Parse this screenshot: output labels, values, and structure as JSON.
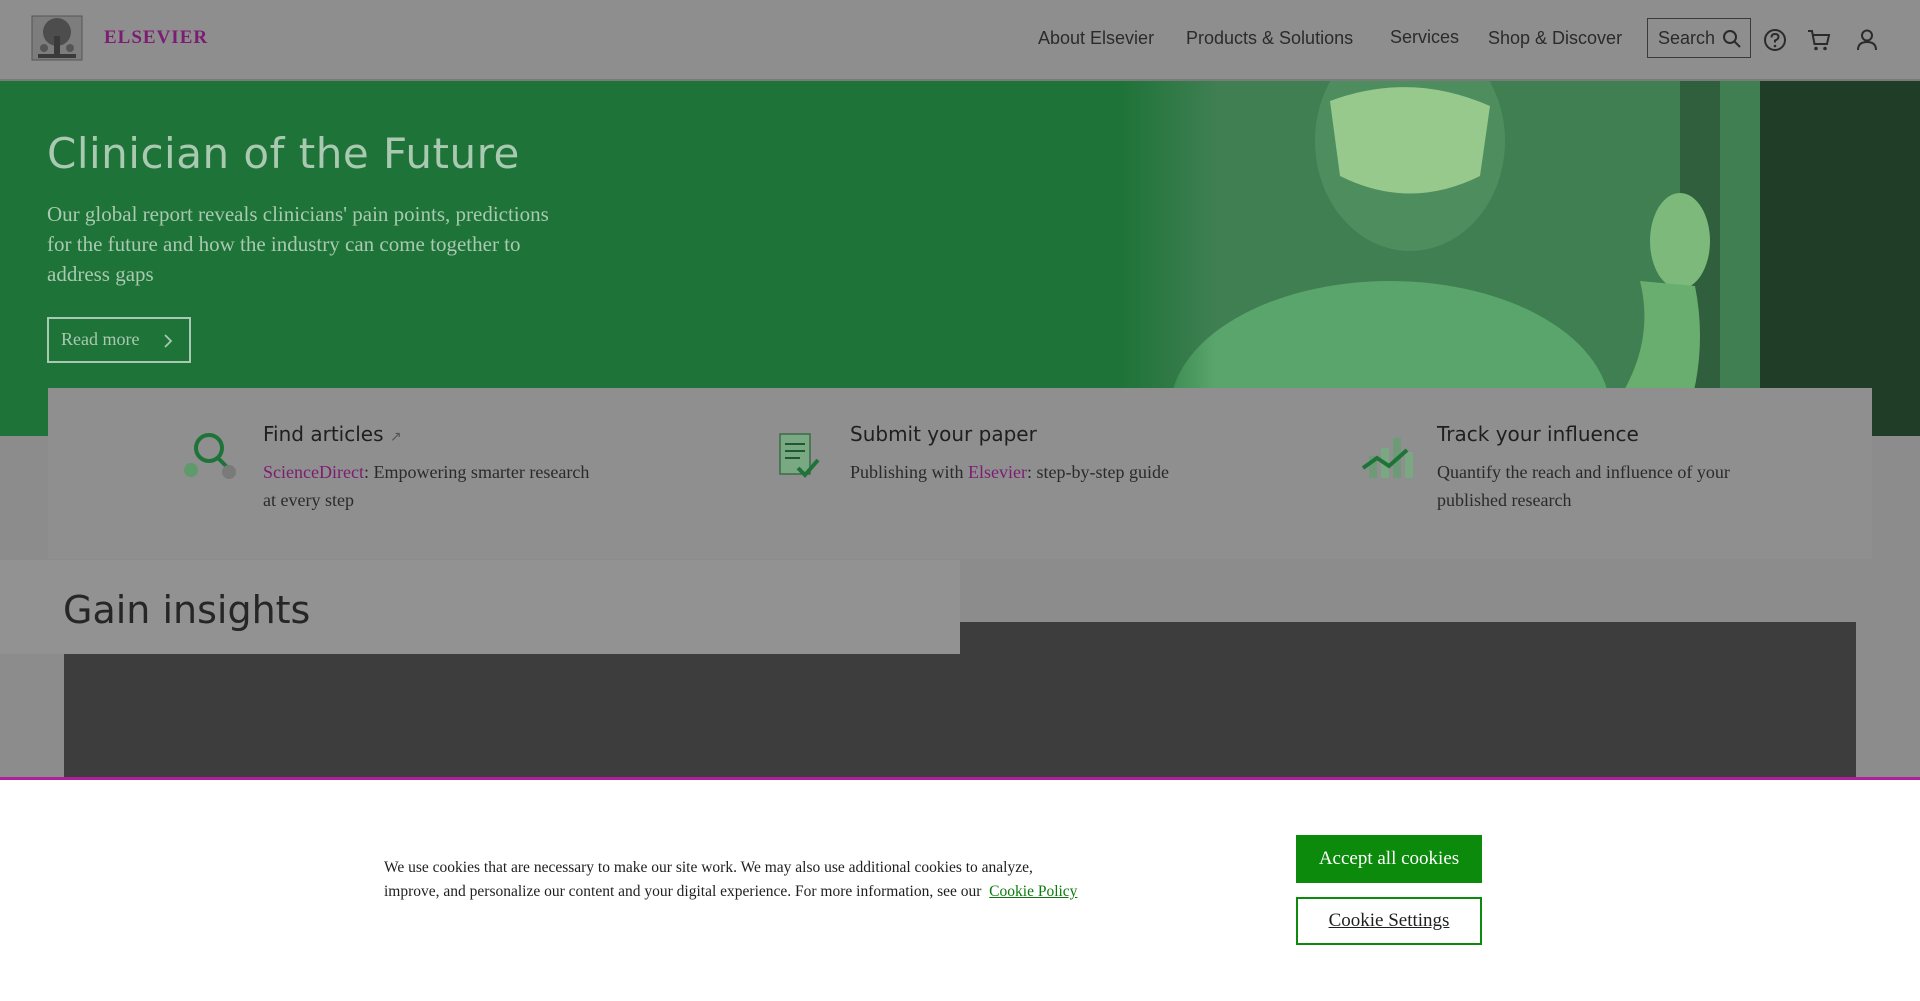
{
  "header": {
    "brand": "ELSEVIER",
    "nav": [
      "About Elsevier",
      "Products & Solutions",
      "Services",
      "Shop & Discover"
    ],
    "search_label": "Search",
    "icons": [
      "help-icon",
      "cart-icon",
      "account-icon"
    ]
  },
  "hero": {
    "title": "Clinician of the Future",
    "subtitle": "Our global report reveals clinicians' pain points, predictions for the future and how the industry can come together to address gaps",
    "button": "Read more"
  },
  "quick_links": [
    {
      "title": "Find articles",
      "accent": "ScienceDirect",
      "desc_before": "",
      "desc_after": ": Empowering smarter research at every step",
      "icon": "search-articles-icon"
    },
    {
      "title": "Submit your paper",
      "desc_before": "Publishing with ",
      "accent": "Elsevier",
      "desc_after": ": step-by-step guide",
      "icon": "submit-paper-icon"
    },
    {
      "title": "Track your influence",
      "desc_before": "Quantify the reach and influence of your published research",
      "accent": "",
      "desc_after": "",
      "icon": "track-influence-icon"
    }
  ],
  "insights": {
    "title": "Gain insights"
  },
  "cookie": {
    "text": "We use cookies that are necessary to make our site work. We may also use additional cookies to analyze, improve, and personalize our content and your digital experience. For more information, see our",
    "link": "Cookie Policy",
    "accept": "Accept all cookies",
    "settings": "Cookie Settings"
  },
  "colors": {
    "hero_green": "#1e7338",
    "accent_purple": "#7b1d73",
    "cookie_green": "#0c8a0c",
    "banner_border": "#b01ea0"
  }
}
